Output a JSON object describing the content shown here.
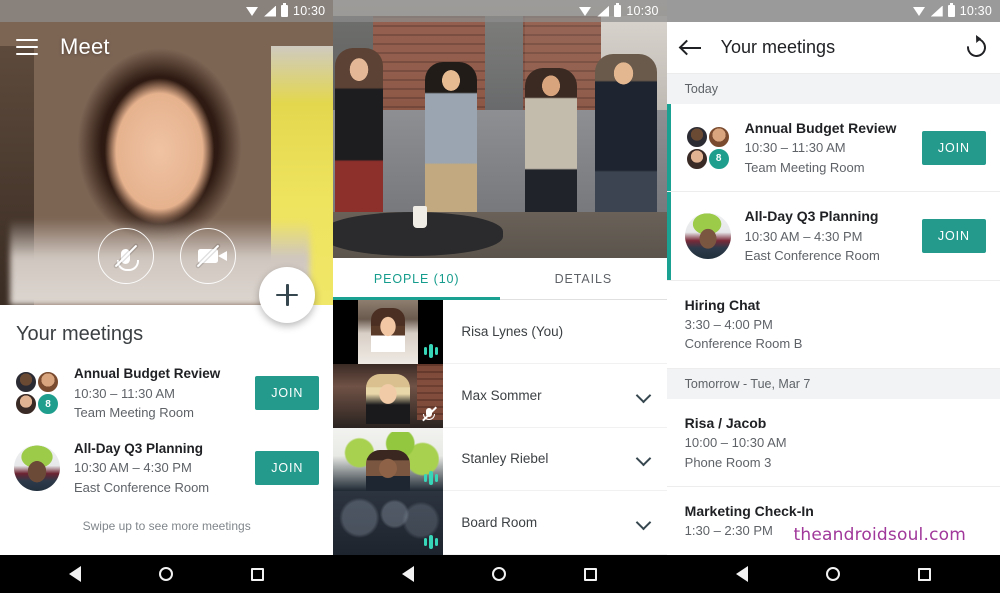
{
  "status_bar": {
    "time": "10:30",
    "icons": [
      "wifi-icon",
      "signal-icon",
      "battery-icon"
    ]
  },
  "nav_bar": {
    "back": "back-icon",
    "home": "home-icon",
    "recents": "recents-icon"
  },
  "panel1": {
    "app_title": "Meet",
    "menu_icon": "hamburger-menu-icon",
    "controls": [
      {
        "name": "mic-off-button",
        "icon": "microphone-muted-icon"
      },
      {
        "name": "camera-off-button",
        "icon": "video-camera-off-icon"
      }
    ],
    "fab": {
      "icon": "plus-icon",
      "label": "+"
    },
    "sheet_title": "Your meetings",
    "meetings": [
      {
        "name": "Annual Budget Review",
        "time": "10:30 – 11:30 AM",
        "room": "Team Meeting Room",
        "join_label": "JOIN",
        "avatar_count": "8"
      },
      {
        "name": "All-Day Q3 Planning",
        "time": "10:30 AM – 4:30 PM",
        "room": "East Conference Room",
        "join_label": "JOIN"
      }
    ],
    "swipe_hint": "Swipe up to see more meetings"
  },
  "panel2": {
    "tabs": [
      {
        "label": "PEOPLE (10)",
        "active": true
      },
      {
        "label": "DETAILS",
        "active": false
      }
    ],
    "participants": [
      {
        "name": "Risa Lynes (You)",
        "audio": "speaking",
        "expand": false
      },
      {
        "name": "Max Sommer",
        "audio": "muted",
        "expand": true
      },
      {
        "name": "Stanley Riebel",
        "audio": "speaking",
        "expand": true
      },
      {
        "name": "Board Room",
        "audio": "speaking",
        "expand": true
      }
    ]
  },
  "panel3": {
    "back_icon": "back-arrow-icon",
    "title": "Your meetings",
    "refresh_icon": "refresh-icon",
    "sections": [
      {
        "header": "Today",
        "items": [
          {
            "name": "Annual Budget Review",
            "time": "10:30 – 11:30 AM",
            "room": "Team Meeting Room",
            "join_label": "JOIN",
            "avatar_count": "8",
            "accent": true
          },
          {
            "name": "All-Day Q3 Planning",
            "time": "10:30 AM – 4:30 PM",
            "room": "East Conference Room",
            "join_label": "JOIN",
            "accent": true
          },
          {
            "name": "Hiring Chat",
            "time": "3:30 – 4:00 PM",
            "room": "Conference Room B",
            "accent": false
          }
        ]
      },
      {
        "header": "Tomorrow - Tue, Mar 7",
        "items": [
          {
            "name": "Risa / Jacob",
            "time": "10:00 – 10:30 AM",
            "room": "Phone Room 3",
            "accent": false
          },
          {
            "name": "Marketing Check-In",
            "time": "1:30 – 2:30 PM",
            "room": "",
            "accent": false
          }
        ]
      }
    ]
  },
  "watermark": "theandroidsoul.com",
  "colors": {
    "accent_teal": "#1aa191",
    "join_button": "#239a8c",
    "watermark": "#a0379a"
  }
}
